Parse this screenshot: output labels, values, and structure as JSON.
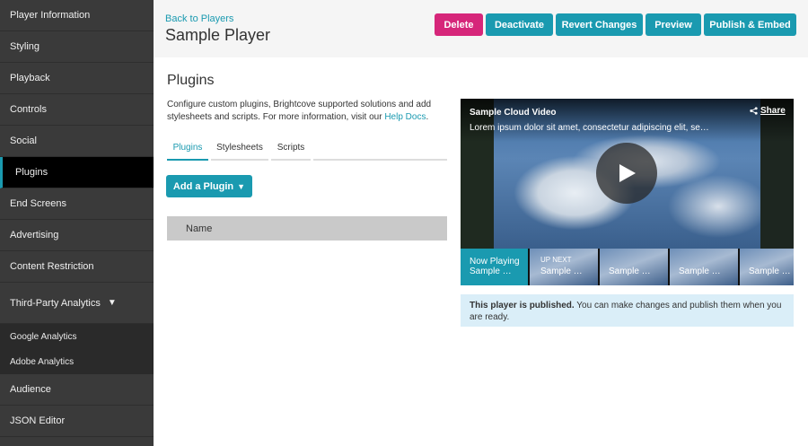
{
  "sidebar": {
    "items": [
      {
        "label": "Player Information"
      },
      {
        "label": "Styling"
      },
      {
        "label": "Playback"
      },
      {
        "label": "Controls"
      },
      {
        "label": "Social"
      },
      {
        "label": "Plugins"
      },
      {
        "label": "End Screens"
      },
      {
        "label": "Advertising"
      },
      {
        "label": "Content Restriction"
      },
      {
        "label": "Third-Party Analytics"
      }
    ],
    "subitems": [
      {
        "label": "Google Analytics"
      },
      {
        "label": "Adobe Analytics"
      }
    ],
    "bottom_items": [
      {
        "label": "Audience"
      },
      {
        "label": "JSON Editor"
      }
    ],
    "dropdown_glyph": "▼"
  },
  "header": {
    "back_link": "Back to Players",
    "title": "Sample Player",
    "buttons": {
      "delete": "Delete",
      "deactivate": "Deactivate",
      "revert": "Revert Changes",
      "preview": "Preview",
      "publish": "Publish & Embed"
    }
  },
  "main": {
    "section_title": "Plugins",
    "description": "Configure custom plugins, Brightcove supported solutions and add stylesheets and scripts. For more information, visit our",
    "help_link": "Help Docs",
    "description_end": ".",
    "tabs": [
      {
        "label": "Plugins"
      },
      {
        "label": "Stylesheets"
      },
      {
        "label": "Scripts"
      }
    ],
    "add_plugin_label": "Add a Plugin",
    "table": {
      "columns": [
        "Name"
      ]
    }
  },
  "player": {
    "video_title": "Sample Cloud Video",
    "video_desc": "Lorem ipsum dolor sit amet, consectetur adipiscing elit, se…",
    "share_label": "Share",
    "playlist": [
      {
        "line1": "Now Playing",
        "line2": "Sample …"
      },
      {
        "up_next": "UP NEXT",
        "line2": "Sample …"
      },
      {
        "line2": "Sample …"
      },
      {
        "line2": "Sample …"
      },
      {
        "line2": "Sample …"
      }
    ]
  },
  "notice": {
    "bold": "This player is published.",
    "text": " You can make changes and publish them when you are ready."
  },
  "colors": {
    "accent": "#1a9ab0",
    "danger": "#d6267a",
    "sidebar": "#3a3a3a",
    "sidebar_active": "#000000",
    "notice_bg": "#daeef8"
  }
}
